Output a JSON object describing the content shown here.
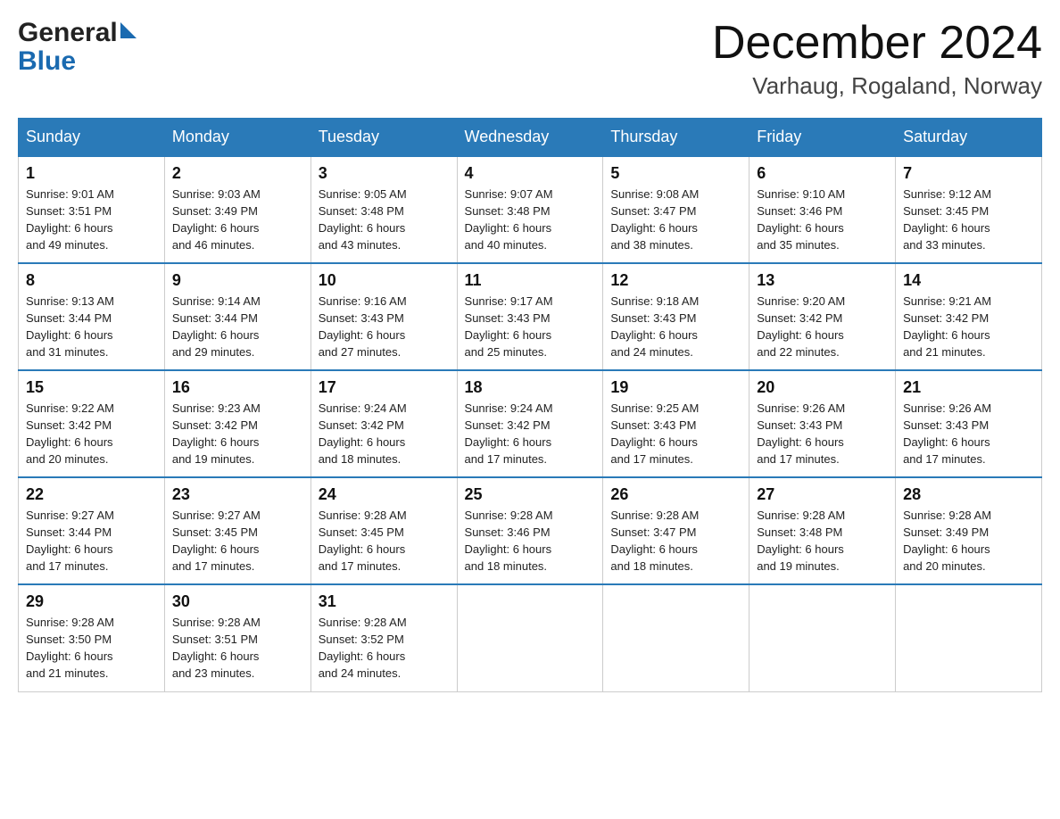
{
  "header": {
    "logo_general": "General",
    "logo_blue": "Blue",
    "title": "December 2024",
    "subtitle": "Varhaug, Rogaland, Norway"
  },
  "days_of_week": [
    "Sunday",
    "Monday",
    "Tuesday",
    "Wednesday",
    "Thursday",
    "Friday",
    "Saturday"
  ],
  "weeks": [
    [
      {
        "day": "1",
        "sunrise": "Sunrise: 9:01 AM",
        "sunset": "Sunset: 3:51 PM",
        "daylight": "Daylight: 6 hours",
        "daylight2": "and 49 minutes."
      },
      {
        "day": "2",
        "sunrise": "Sunrise: 9:03 AM",
        "sunset": "Sunset: 3:49 PM",
        "daylight": "Daylight: 6 hours",
        "daylight2": "and 46 minutes."
      },
      {
        "day": "3",
        "sunrise": "Sunrise: 9:05 AM",
        "sunset": "Sunset: 3:48 PM",
        "daylight": "Daylight: 6 hours",
        "daylight2": "and 43 minutes."
      },
      {
        "day": "4",
        "sunrise": "Sunrise: 9:07 AM",
        "sunset": "Sunset: 3:48 PM",
        "daylight": "Daylight: 6 hours",
        "daylight2": "and 40 minutes."
      },
      {
        "day": "5",
        "sunrise": "Sunrise: 9:08 AM",
        "sunset": "Sunset: 3:47 PM",
        "daylight": "Daylight: 6 hours",
        "daylight2": "and 38 minutes."
      },
      {
        "day": "6",
        "sunrise": "Sunrise: 9:10 AM",
        "sunset": "Sunset: 3:46 PM",
        "daylight": "Daylight: 6 hours",
        "daylight2": "and 35 minutes."
      },
      {
        "day": "7",
        "sunrise": "Sunrise: 9:12 AM",
        "sunset": "Sunset: 3:45 PM",
        "daylight": "Daylight: 6 hours",
        "daylight2": "and 33 minutes."
      }
    ],
    [
      {
        "day": "8",
        "sunrise": "Sunrise: 9:13 AM",
        "sunset": "Sunset: 3:44 PM",
        "daylight": "Daylight: 6 hours",
        "daylight2": "and 31 minutes."
      },
      {
        "day": "9",
        "sunrise": "Sunrise: 9:14 AM",
        "sunset": "Sunset: 3:44 PM",
        "daylight": "Daylight: 6 hours",
        "daylight2": "and 29 minutes."
      },
      {
        "day": "10",
        "sunrise": "Sunrise: 9:16 AM",
        "sunset": "Sunset: 3:43 PM",
        "daylight": "Daylight: 6 hours",
        "daylight2": "and 27 minutes."
      },
      {
        "day": "11",
        "sunrise": "Sunrise: 9:17 AM",
        "sunset": "Sunset: 3:43 PM",
        "daylight": "Daylight: 6 hours",
        "daylight2": "and 25 minutes."
      },
      {
        "day": "12",
        "sunrise": "Sunrise: 9:18 AM",
        "sunset": "Sunset: 3:43 PM",
        "daylight": "Daylight: 6 hours",
        "daylight2": "and 24 minutes."
      },
      {
        "day": "13",
        "sunrise": "Sunrise: 9:20 AM",
        "sunset": "Sunset: 3:42 PM",
        "daylight": "Daylight: 6 hours",
        "daylight2": "and 22 minutes."
      },
      {
        "day": "14",
        "sunrise": "Sunrise: 9:21 AM",
        "sunset": "Sunset: 3:42 PM",
        "daylight": "Daylight: 6 hours",
        "daylight2": "and 21 minutes."
      }
    ],
    [
      {
        "day": "15",
        "sunrise": "Sunrise: 9:22 AM",
        "sunset": "Sunset: 3:42 PM",
        "daylight": "Daylight: 6 hours",
        "daylight2": "and 20 minutes."
      },
      {
        "day": "16",
        "sunrise": "Sunrise: 9:23 AM",
        "sunset": "Sunset: 3:42 PM",
        "daylight": "Daylight: 6 hours",
        "daylight2": "and 19 minutes."
      },
      {
        "day": "17",
        "sunrise": "Sunrise: 9:24 AM",
        "sunset": "Sunset: 3:42 PM",
        "daylight": "Daylight: 6 hours",
        "daylight2": "and 18 minutes."
      },
      {
        "day": "18",
        "sunrise": "Sunrise: 9:24 AM",
        "sunset": "Sunset: 3:42 PM",
        "daylight": "Daylight: 6 hours",
        "daylight2": "and 17 minutes."
      },
      {
        "day": "19",
        "sunrise": "Sunrise: 9:25 AM",
        "sunset": "Sunset: 3:43 PM",
        "daylight": "Daylight: 6 hours",
        "daylight2": "and 17 minutes."
      },
      {
        "day": "20",
        "sunrise": "Sunrise: 9:26 AM",
        "sunset": "Sunset: 3:43 PM",
        "daylight": "Daylight: 6 hours",
        "daylight2": "and 17 minutes."
      },
      {
        "day": "21",
        "sunrise": "Sunrise: 9:26 AM",
        "sunset": "Sunset: 3:43 PM",
        "daylight": "Daylight: 6 hours",
        "daylight2": "and 17 minutes."
      }
    ],
    [
      {
        "day": "22",
        "sunrise": "Sunrise: 9:27 AM",
        "sunset": "Sunset: 3:44 PM",
        "daylight": "Daylight: 6 hours",
        "daylight2": "and 17 minutes."
      },
      {
        "day": "23",
        "sunrise": "Sunrise: 9:27 AM",
        "sunset": "Sunset: 3:45 PM",
        "daylight": "Daylight: 6 hours",
        "daylight2": "and 17 minutes."
      },
      {
        "day": "24",
        "sunrise": "Sunrise: 9:28 AM",
        "sunset": "Sunset: 3:45 PM",
        "daylight": "Daylight: 6 hours",
        "daylight2": "and 17 minutes."
      },
      {
        "day": "25",
        "sunrise": "Sunrise: 9:28 AM",
        "sunset": "Sunset: 3:46 PM",
        "daylight": "Daylight: 6 hours",
        "daylight2": "and 18 minutes."
      },
      {
        "day": "26",
        "sunrise": "Sunrise: 9:28 AM",
        "sunset": "Sunset: 3:47 PM",
        "daylight": "Daylight: 6 hours",
        "daylight2": "and 18 minutes."
      },
      {
        "day": "27",
        "sunrise": "Sunrise: 9:28 AM",
        "sunset": "Sunset: 3:48 PM",
        "daylight": "Daylight: 6 hours",
        "daylight2": "and 19 minutes."
      },
      {
        "day": "28",
        "sunrise": "Sunrise: 9:28 AM",
        "sunset": "Sunset: 3:49 PM",
        "daylight": "Daylight: 6 hours",
        "daylight2": "and 20 minutes."
      }
    ],
    [
      {
        "day": "29",
        "sunrise": "Sunrise: 9:28 AM",
        "sunset": "Sunset: 3:50 PM",
        "daylight": "Daylight: 6 hours",
        "daylight2": "and 21 minutes."
      },
      {
        "day": "30",
        "sunrise": "Sunrise: 9:28 AM",
        "sunset": "Sunset: 3:51 PM",
        "daylight": "Daylight: 6 hours",
        "daylight2": "and 23 minutes."
      },
      {
        "day": "31",
        "sunrise": "Sunrise: 9:28 AM",
        "sunset": "Sunset: 3:52 PM",
        "daylight": "Daylight: 6 hours",
        "daylight2": "and 24 minutes."
      },
      null,
      null,
      null,
      null
    ]
  ]
}
